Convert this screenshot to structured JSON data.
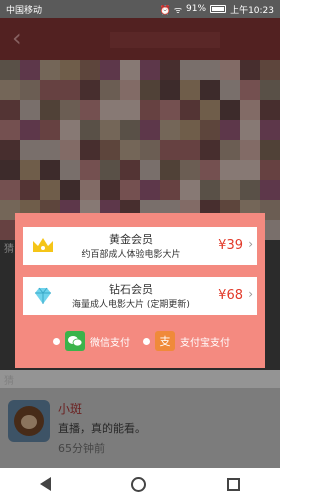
{
  "status_bar": {
    "carrier": "中国移动",
    "battery": "91%",
    "time": "上午10:23",
    "signal_icons": "⏰ ᯤ"
  },
  "header": {
    "back_glyph": "‹"
  },
  "background": {
    "section_label_1": "猜",
    "section_label_2": "猜",
    "list_item": {
      "name": "小斑",
      "desc": "直播，真的能看。",
      "desc2": "65分钟前"
    }
  },
  "modal": {
    "plans": [
      {
        "icon": "crown-icon",
        "title": "黄金会员",
        "subtitle": "约百部成人体验电影大片",
        "price": "¥39"
      },
      {
        "icon": "diamond-icon",
        "title": "钻石会员",
        "subtitle": "海量成人电影大片 (定期更新)",
        "price": "¥68"
      }
    ],
    "payment": {
      "wechat_label": "微信支付",
      "alipay_label": "支付宝支付"
    }
  },
  "colors": {
    "modal_bg": "#f48a80",
    "price": "#e23a2a",
    "wechat_green": "#3bb34a",
    "alipay_orange": "#f08a3a"
  }
}
